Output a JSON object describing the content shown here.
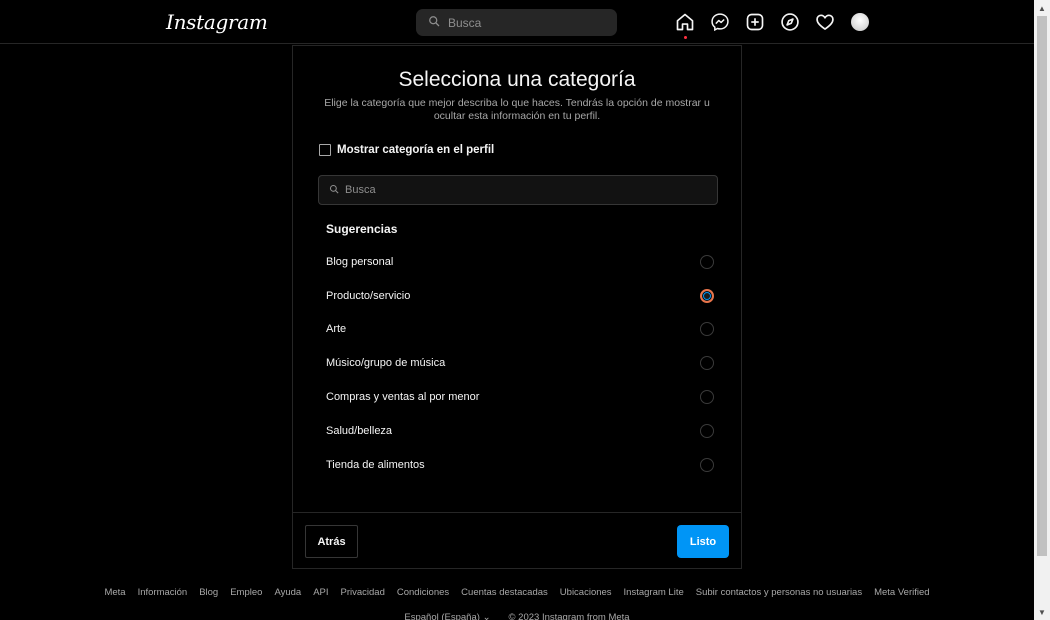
{
  "nav": {
    "logo": "Instagram",
    "search_placeholder": "Busca",
    "icons": [
      "home-icon",
      "messenger-icon",
      "new-post-icon",
      "explore-icon",
      "activity-heart-icon",
      "profile-avatar"
    ]
  },
  "modal": {
    "title": "Selecciona una categoría",
    "description": "Elige la categoría que mejor describa lo que haces. Tendrás la opción de mostrar u ocultar esta información en tu perfil.",
    "show_category_label": "Mostrar categoría en el perfil",
    "show_category_checked": false,
    "search_placeholder": "Busca",
    "suggestions_heading": "Sugerencias",
    "options": [
      {
        "label": "Blog personal",
        "selected": false
      },
      {
        "label": "Producto/servicio",
        "selected": true
      },
      {
        "label": "Arte",
        "selected": false
      },
      {
        "label": "Músico/grupo de música",
        "selected": false
      },
      {
        "label": "Compras y ventas al por menor",
        "selected": false
      },
      {
        "label": "Salud/belleza",
        "selected": false
      },
      {
        "label": "Tienda de alimentos",
        "selected": false
      }
    ],
    "back_label": "Atrás",
    "done_label": "Listo"
  },
  "footer": {
    "links": [
      "Meta",
      "Información",
      "Blog",
      "Empleo",
      "Ayuda",
      "API",
      "Privacidad",
      "Condiciones",
      "Cuentas destacadas",
      "Ubicaciones",
      "Instagram Lite",
      "Subir contactos y personas no usuarias",
      "Meta Verified"
    ],
    "language": "Español (España)",
    "copyright": "© 2023 Instagram from Meta"
  },
  "colors": {
    "accent": "#0095f6",
    "selected_ring": "#e8744a",
    "notification_dot": "#ff3040",
    "background": "#000000"
  }
}
